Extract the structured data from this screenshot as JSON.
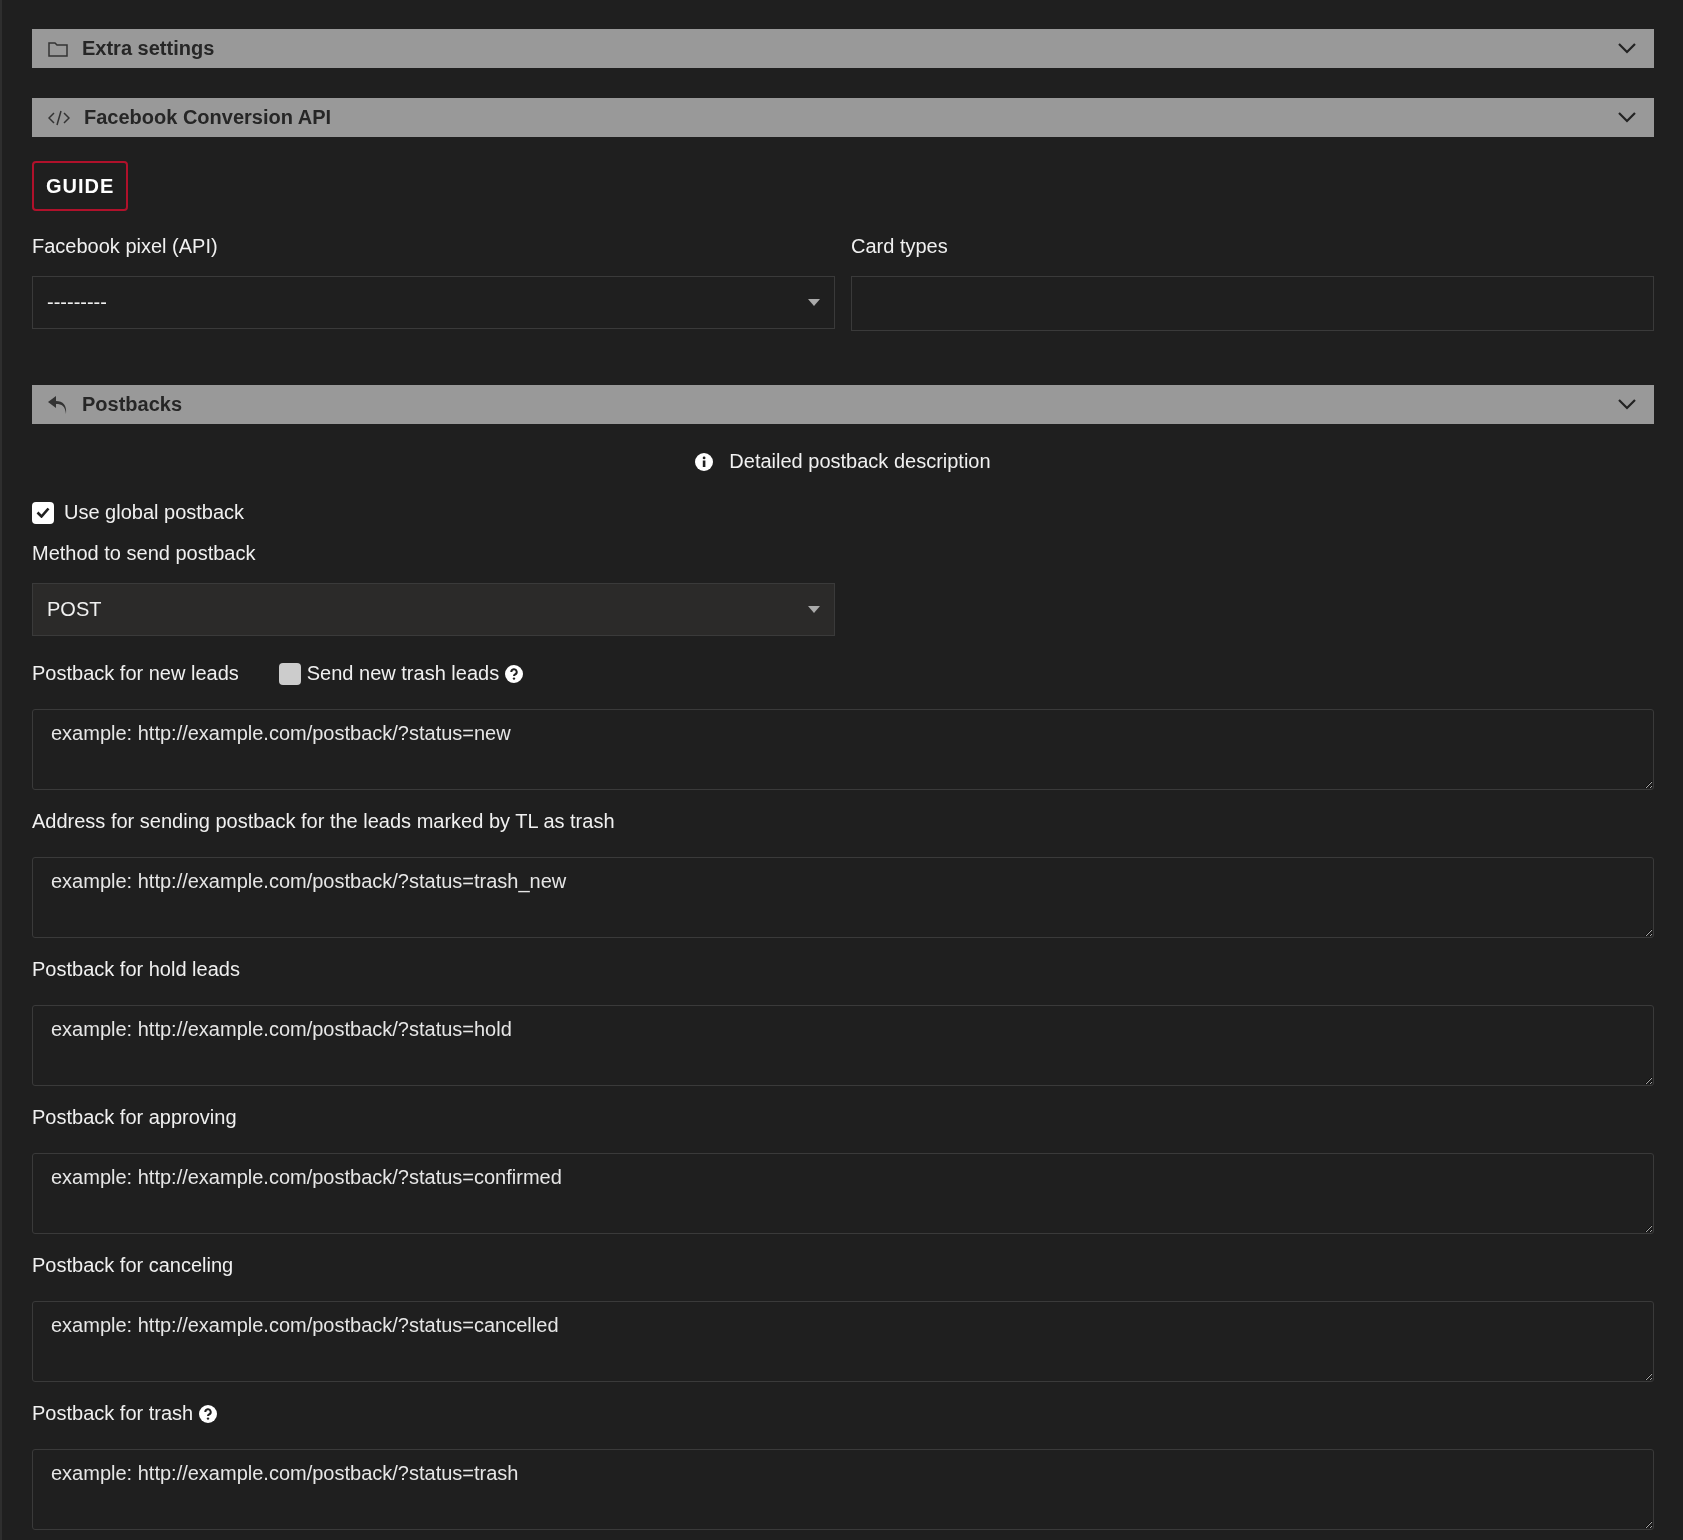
{
  "panels": [
    {
      "title": "Extra settings"
    },
    {
      "title": "Facebook Conversion API"
    }
  ],
  "guide_button": "GUIDE",
  "fb_fields": [
    {
      "kind": "select",
      "label": "Facebook pixel (API)",
      "value": "---------"
    },
    {
      "kind": "input",
      "label": "Card types"
    }
  ],
  "postbacks_panel": {
    "title": "Postbacks"
  },
  "info_link": "Detailed postback description",
  "use_global": {
    "label": "Use global postback",
    "checked": true
  },
  "method": {
    "label": "Method to send postback",
    "value": "POST"
  },
  "postback_fields": [
    {
      "label": "Postback for new leads",
      "placeholder": "example: http://example.com/postback/?status=new",
      "toggle": {
        "label": "Send new trash leads",
        "checked": false
      },
      "help": false
    },
    {
      "label": "Address for sending postback for the leads marked by TL as trash",
      "placeholder": "example: http://example.com/postback/?status=trash_new",
      "help": false
    },
    {
      "label": "Postback for hold leads",
      "placeholder": "example: http://example.com/postback/?status=hold",
      "help": false
    },
    {
      "label": "Postback for approving",
      "placeholder": "example: http://example.com/postback/?status=confirmed",
      "help": false
    },
    {
      "label": "Postback for canceling",
      "placeholder": "example: http://example.com/postback/?status=cancelled",
      "help": false
    },
    {
      "label": "Postback for trash",
      "placeholder": "example: http://example.com/postback/?status=trash",
      "help": true
    }
  ]
}
